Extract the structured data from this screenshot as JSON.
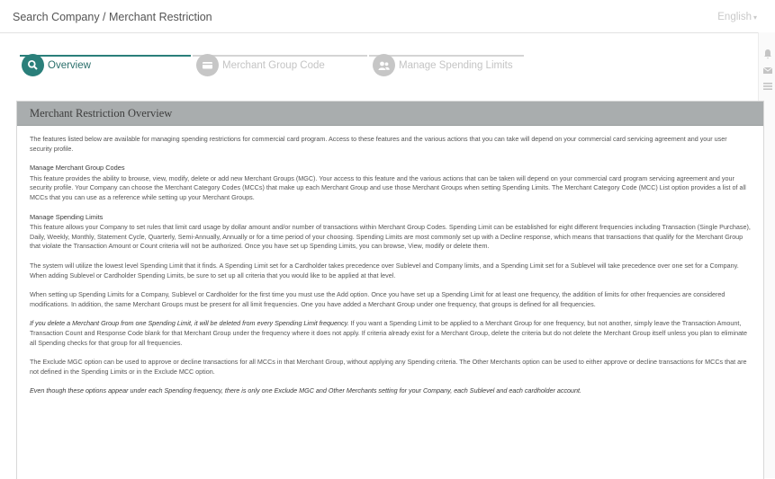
{
  "header": {
    "breadcrumb": "Search Company / Merchant Restriction",
    "language": "English"
  },
  "colors": {
    "accent": "#2a7f7a",
    "inactive": "#c6c6c6",
    "panel_header": "#a9adae"
  },
  "steps": [
    {
      "label": "Overview",
      "icon": "search-icon",
      "state": "active"
    },
    {
      "label": "Merchant Group Code",
      "icon": "card-icon",
      "state": "inactive"
    },
    {
      "label": "Manage Spending Limits",
      "icon": "user-group-icon",
      "state": "inactive"
    }
  ],
  "panel": {
    "title": "Merchant Restriction Overview",
    "intro": "The features listed below are available for managing spending restrictions for commercial card program. Access to these features and the various actions that you can take will depend on your commercial card servicing agreement and your user security profile.",
    "section1_title": "Manage Merchant Group Codes",
    "section1_body": "This feature provides the ability to browse, view, modify, delete or add new Merchant Groups (MGC). Your access to this feature and the various actions that can be taken will depend on your commercial card program servicing agreement and your security profile. Your Company can choose the Merchant Category Codes (MCCs) that make up each Merchant Group and use those Merchant Groups when setting Spending Limits. The Merchant Category Code (MCC) List option provides a list of all MCCs that you can use as a reference while setting up your Merchant Groups.",
    "section2_title": "Manage Spending Limits",
    "section2_body": "This feature allows your Company to set rules that limit card usage by dollar amount and/or number of transactions within Merchant Group Codes. Spending Limit can be established for eight different frequencies including Transaction (Single Purchase), Daily, Weekly, Monthly, Statement Cycle, Quarterly, Semi-Annually, Annually or for a time period of your choosing. Spending Limits are most commonly set up with a Decline response, which means that transactions that qualify for the Merchant Group that violate the Transaction Amount or Count criteria will not be authorized. Once you have set up Spending Limits, you can browse, View, modify or delete them.",
    "para3": "The system will utilize the lowest level Spending Limit that it finds. A Spending Limit set for a Cardholder takes precedence over Sublevel and Company limits, and a Spending Limit set for a Sublevel will take precedence over one set for a Company. When adding Sublevel or Cardholder Spending Limits, be sure to set up all criteria that you would like to be applied at that level.",
    "para4": "When setting up Spending Limits for a Company, Sublevel or Cardholder for the first time you must use the Add option. Once you have set up a Spending Limit for at least one frequency, the addition of limits for other frequencies are considered modifications. In addition, the same Merchant Groups must be present for all limit frequencies. One you have added a Merchant Group under one frequency, that groups is defined for all frequencies.",
    "para5_em": "If you delete a Merchant Group from one Spending Limit, it will be deleted from every Spending Limit frequency.",
    "para5_rest": " If you want a Spending Limit to be applied to a Merchant Group for one frequency, but not another, simply leave the Transaction Amount, Transaction Count and Response Code blank for that Merchant Group under the frequency where it does not apply. If criteria already exist for a Merchant Group, delete the criteria but do not delete the Merchant Group itself unless you plan to eliminate all Spending checks for that group for all frequencies.",
    "para6": "The Exclude MGC option can be used to approve or decline transactions for all MCCs in that Merchant Group, without applying any Spending criteria. The Other Merchants option can be used to either approve or decline transactions for MCCs that are not defined in the Spending Limits or in the Exclude MCC option.",
    "para7_em": "Even though these options appear under each Spending frequency, there is only one Exclude MGC and Other Merchants setting for your Company, each Sublevel and each cardholder account."
  },
  "rail_icons": [
    "bell-icon",
    "mail-icon",
    "list-icon"
  ]
}
